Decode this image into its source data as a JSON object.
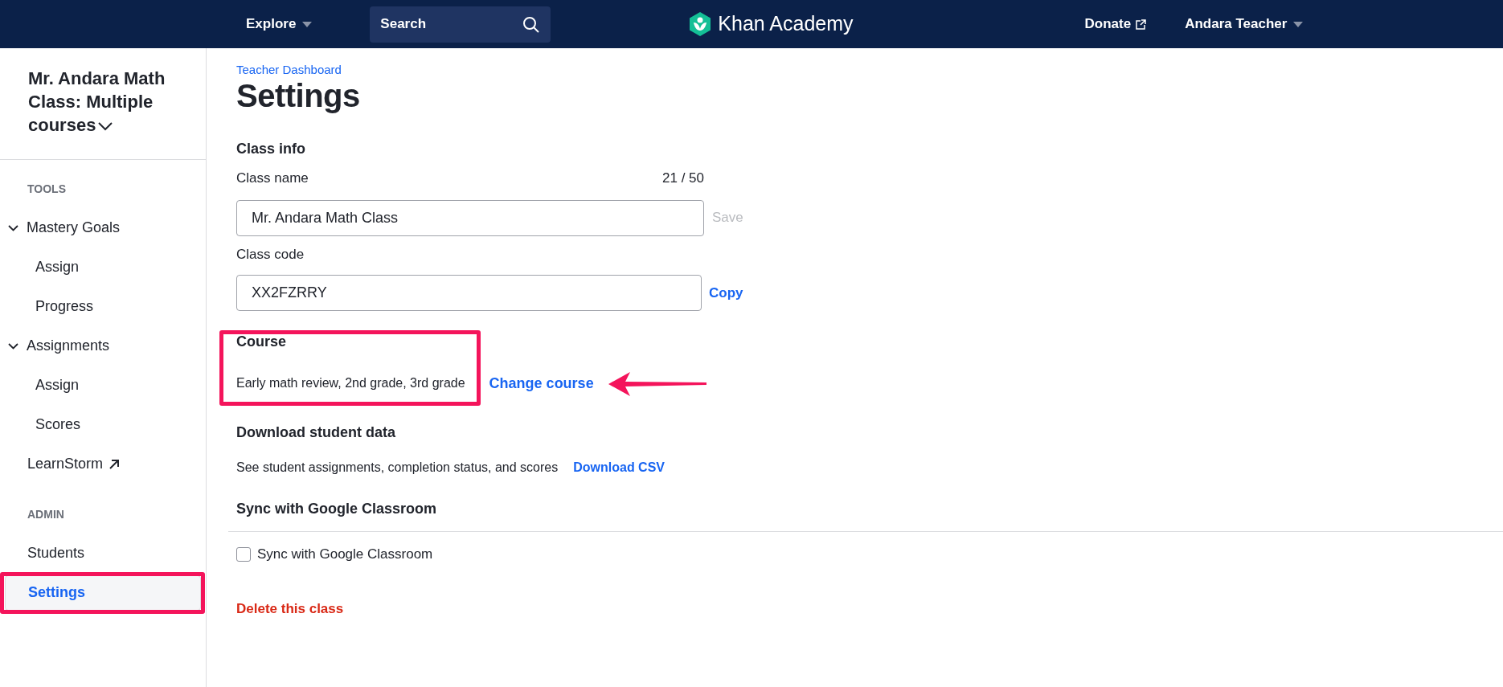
{
  "nav": {
    "explore": "Explore",
    "search": {
      "placeholder": "Search"
    },
    "logo": "Khan Academy",
    "donate": "Donate",
    "user": "Andara Teacher"
  },
  "sidebar": {
    "class_title": "Mr. Andara Math Class: Multiple courses",
    "sections": [
      {
        "heading": "TOOLS",
        "items": [
          {
            "label": "Mastery Goals",
            "kind": "group",
            "expanded": true,
            "selected": false,
            "children": [
              {
                "label": "Assign",
                "selected": false
              },
              {
                "label": "Progress",
                "selected": false
              }
            ]
          },
          {
            "label": "Assignments",
            "kind": "group",
            "expanded": true,
            "selected": false,
            "children": [
              {
                "label": "Assign",
                "selected": false
              },
              {
                "label": "Scores",
                "selected": false
              }
            ]
          },
          {
            "label": "LearnStorm",
            "kind": "external",
            "selected": false
          }
        ]
      },
      {
        "heading": "ADMIN",
        "items": [
          {
            "label": "Students",
            "kind": "link",
            "selected": false
          },
          {
            "label": "Settings",
            "kind": "link",
            "selected": true,
            "highlighted": true
          }
        ]
      }
    ]
  },
  "page": {
    "breadcrumb": "Teacher Dashboard",
    "title": "Settings",
    "class_info": {
      "heading": "Class info",
      "name_label": "Class name",
      "name_count": "21 / 50",
      "name_value": "Mr. Andara Math Class",
      "save": "Save",
      "code_label": "Class code",
      "code_value": "XX2FZRRY",
      "copy": "Copy"
    },
    "course": {
      "heading": "Course",
      "value": "Early math review, 2nd grade, 3rd grade",
      "change": "Change course",
      "highlighted": true
    },
    "download": {
      "heading": "Download student data",
      "description": "See student assignments, completion status, and scores",
      "link": "Download CSV"
    },
    "sync": {
      "heading": "Sync with Google Classroom",
      "checkbox_label": "Sync with Google Classroom",
      "checked": false
    },
    "delete": "Delete this class"
  }
}
